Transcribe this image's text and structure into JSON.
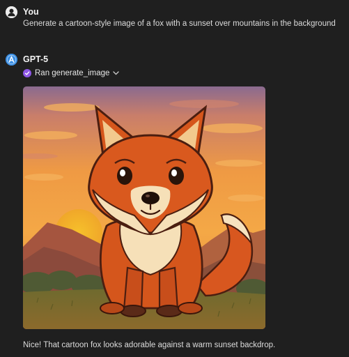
{
  "user_message": {
    "author": "You",
    "text": "Generate a cartoon-style image of a fox with a sunset over mountains in the background",
    "avatar_icon": "user-silhouette-icon"
  },
  "assistant_message": {
    "author": "GPT-5",
    "avatar_icon": "gpt-logo-icon",
    "tool_call": {
      "label": "Ran generate_image",
      "status_icon": "check-circle-icon",
      "expand_icon": "chevron-down-icon"
    },
    "image": {
      "subject": "cartoon fox sitting in front of a sunset over mountains"
    },
    "reply": "Nice! That cartoon fox looks adorable against a warm sunset backdrop."
  },
  "colors": {
    "background": "#1f1f1f",
    "text": "#dcdcdc",
    "gpt_avatar": "#3b8fe4",
    "tool_badge": "#8e57e6"
  }
}
